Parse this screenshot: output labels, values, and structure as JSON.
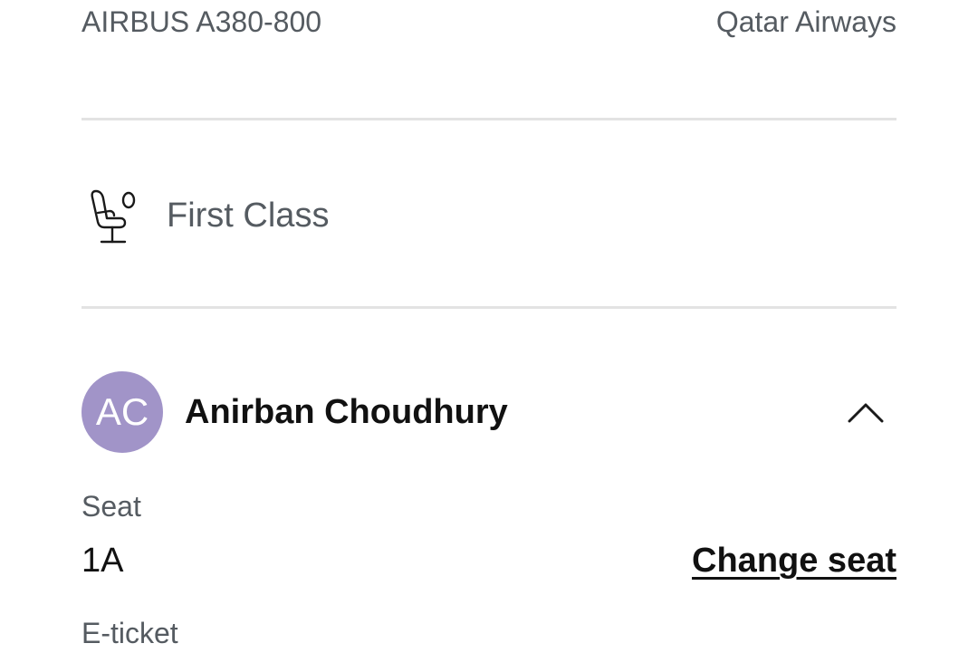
{
  "flight": {
    "aircraft": "AIRBUS A380-800",
    "airline": "Qatar Airways"
  },
  "cabin": {
    "icon": "seat-icon",
    "label": "First Class"
  },
  "passenger": {
    "initials": "AC",
    "avatar_color": "#a194c8",
    "name": "Anirban Choudhury",
    "toggle_icon": "chevron-up-icon"
  },
  "seat": {
    "label": "Seat",
    "value": "1A",
    "change_link": "Change seat"
  },
  "eticket": {
    "label": "E-ticket"
  }
}
